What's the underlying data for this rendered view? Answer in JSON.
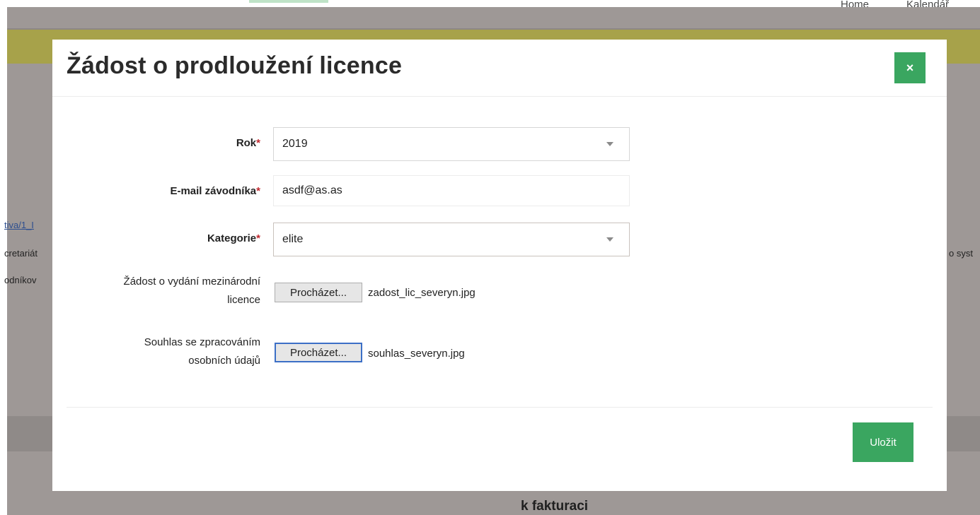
{
  "background": {
    "nav": {
      "home": "Home",
      "calendar": "Kalendář"
    },
    "left_snippets": {
      "link": "tiva/1_I",
      "line2": "cretariát",
      "line3": "odníkov"
    },
    "right_snippet": "o syst",
    "section_heading": "k fakturaci"
  },
  "modal": {
    "title": "Žádost o prodloužení licence",
    "close_label": "×",
    "required_mark": "*",
    "fields": {
      "rok": {
        "label": "Rok",
        "value": "2019"
      },
      "email": {
        "label": "E-mail závodníka",
        "value": "asdf@as.as"
      },
      "kategorie": {
        "label": "Kategorie",
        "value": "elite"
      },
      "zadost": {
        "label_line1": "Žádost o vydání mezinárodní",
        "label_line2": "licence",
        "button": "Procházet...",
        "file": "zadost_lic_severyn.jpg"
      },
      "souhlas": {
        "label_line1": "Souhlas se zpracováním",
        "label_line2": "osobních údajů",
        "button": "Procházet...",
        "file": "souhlas_severyn.jpg"
      }
    },
    "save_label": "Uložit"
  },
  "colors": {
    "accent_green": "#3aa660",
    "overlay": "#9e9896",
    "olive_bar": "#a7a24a",
    "required": "#c0282f"
  }
}
